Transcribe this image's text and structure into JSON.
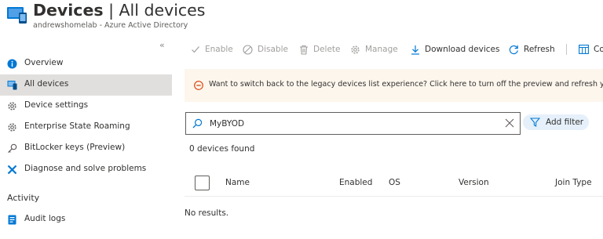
{
  "header": {
    "title_bold": "Devices",
    "title_rest": " | All devices",
    "more": "···",
    "subtitle": "andrewshomelab - Azure Active Directory"
  },
  "sidebar": {
    "collapse": "«",
    "items": [
      {
        "label": "Overview",
        "icon": "info-icon",
        "selected": false
      },
      {
        "label": "All devices",
        "icon": "devices-icon",
        "selected": true
      },
      {
        "label": "Device settings",
        "icon": "gear-icon",
        "selected": false
      },
      {
        "label": "Enterprise State Roaming",
        "icon": "gear-icon",
        "selected": false
      },
      {
        "label": "BitLocker keys (Preview)",
        "icon": "key-icon",
        "selected": false
      },
      {
        "label": "Diagnose and solve problems",
        "icon": "wrench-icon",
        "selected": false
      }
    ],
    "section_activity": "Activity",
    "activity_items": [
      {
        "label": "Audit logs",
        "icon": "audit-log-icon"
      }
    ]
  },
  "toolbar": {
    "enable": "Enable",
    "disable": "Disable",
    "delete": "Delete",
    "manage": "Manage",
    "download": "Download devices",
    "refresh": "Refresh",
    "columns": "Co"
  },
  "banner": {
    "text": "Want to switch back to the legacy devices list experience? Click here to turn off the preview and refresh your bro"
  },
  "search": {
    "value": "MyBYOD",
    "add_filter": "Add filter"
  },
  "results": {
    "count_text": "0 devices found",
    "no_results": "No results."
  },
  "table": {
    "columns": [
      "Name",
      "Enabled",
      "OS",
      "Version",
      "Join Type"
    ]
  },
  "colors": {
    "accent": "#0078d4",
    "selected_bg": "#e1dfdd",
    "banner_bg": "#fdf6ed",
    "warning": "#d83b01",
    "disabled_text": "#a19f9d"
  }
}
